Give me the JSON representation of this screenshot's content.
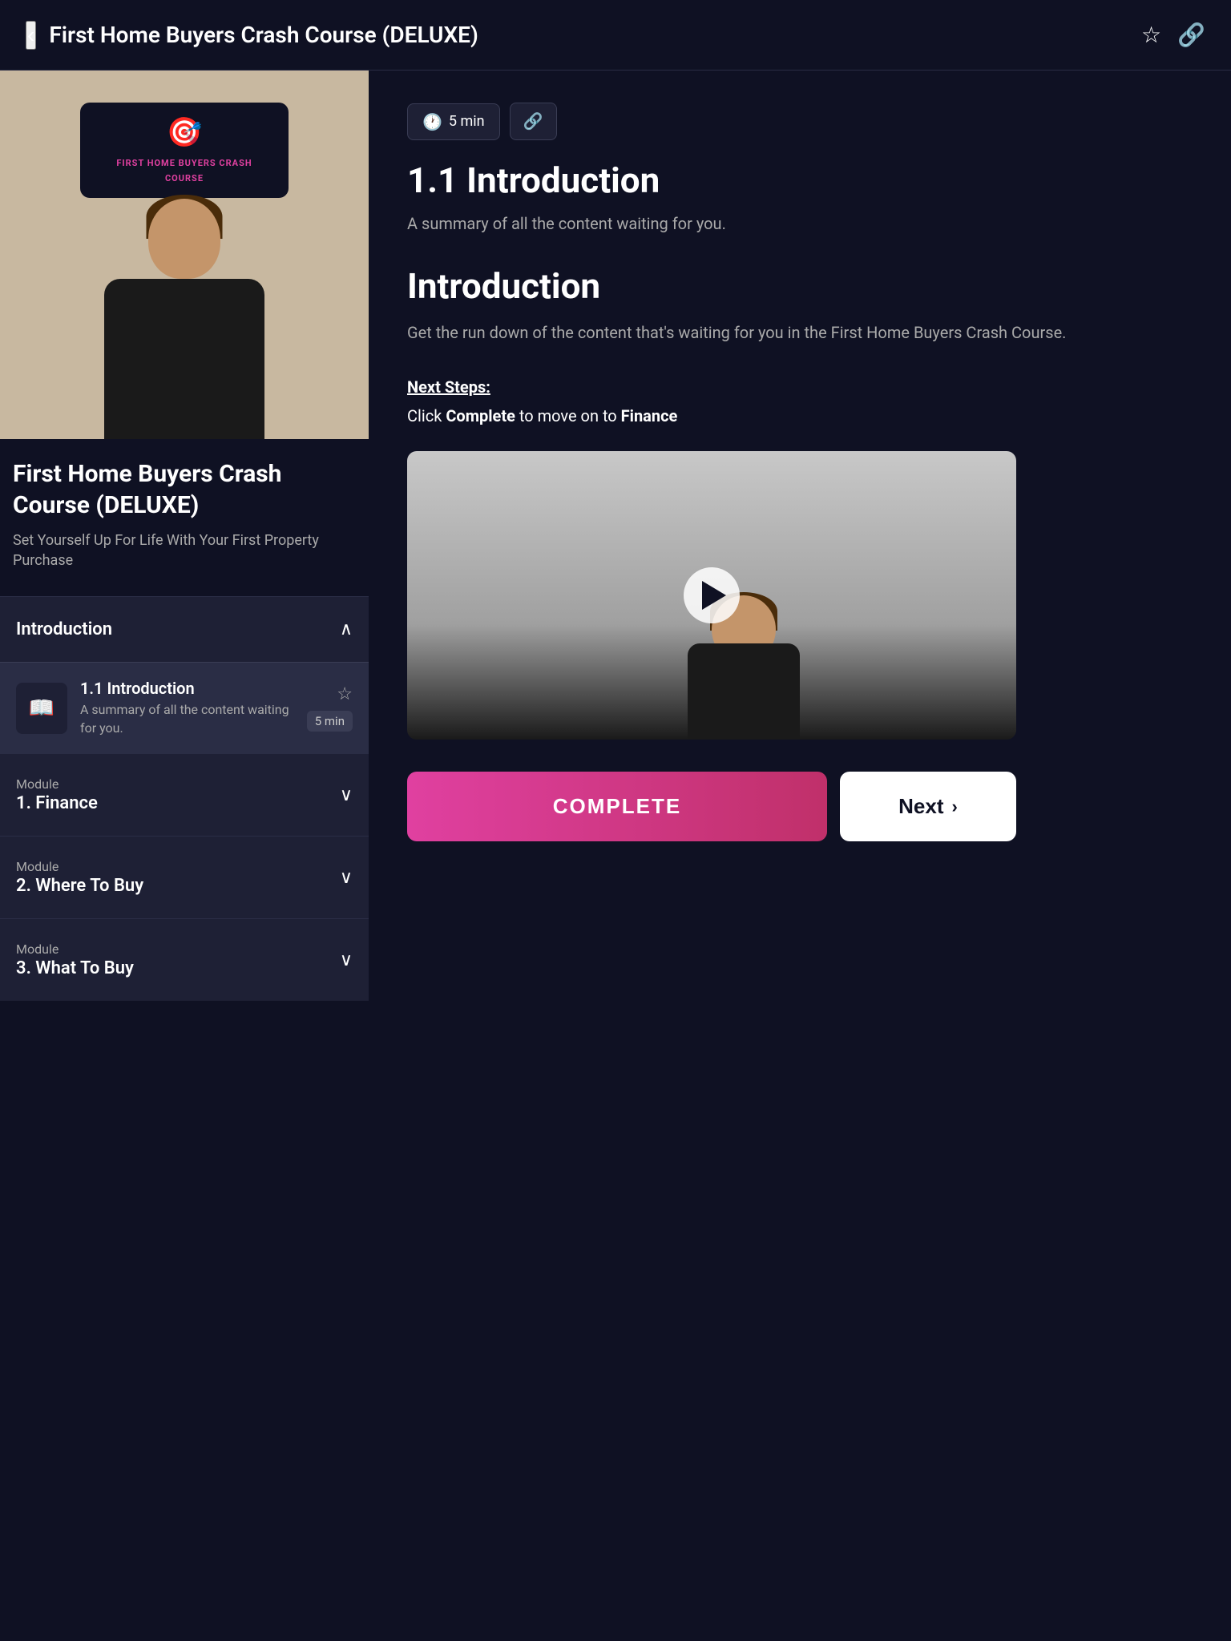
{
  "header": {
    "back_label": "‹",
    "title": "First Home Buyers Crash Course (DELUXE)",
    "bookmark_icon": "☆",
    "share_icon": "🔗"
  },
  "course": {
    "title": "First Home Buyers Crash Course (DELUXE)",
    "subtitle": "Set Yourself Up For Life With Your First Property Purchase",
    "logo_text": "FIRST HOME BUYERS\nCRASH COURSE"
  },
  "sidebar": {
    "introduction_section": {
      "label": "Introduction",
      "chevron": "∧"
    },
    "lesson": {
      "title": "1.1 Introduction",
      "description": "A summary of all the content waiting for you.",
      "duration": "5 min",
      "star_icon": "☆"
    },
    "module1": {
      "sub": "Module",
      "label": "1. Finance",
      "chevron": "∨"
    },
    "module2": {
      "sub": "Module",
      "label": "2. Where To Buy",
      "chevron": "∨"
    },
    "module3": {
      "sub": "Module",
      "label": "3. What To Buy",
      "chevron": "∨"
    }
  },
  "content": {
    "time_badge": "5 min",
    "time_icon": "🕐",
    "link_icon": "🔗",
    "main_title": "1.1 Introduction",
    "summary": "A summary of all the content waiting for you.",
    "section_title": "Introduction",
    "section_body": "Get the run down of the content that's waiting for you in the First Home Buyers Crash Course.",
    "next_steps_label": "Next Steps:",
    "next_steps_text_1": "Click ",
    "next_steps_bold1": "Complete",
    "next_steps_text_2": " to move on to ",
    "next_steps_bold2": "Finance",
    "complete_btn": "COMPLETE",
    "next_btn": "Next",
    "next_arrow": "›"
  }
}
